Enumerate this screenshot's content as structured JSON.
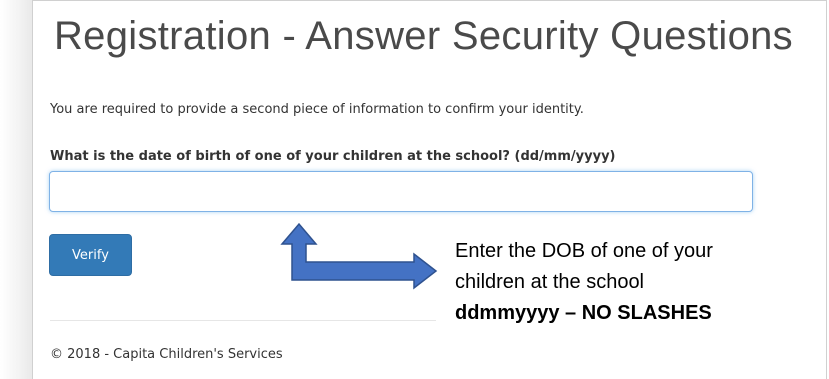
{
  "page": {
    "title": "Registration - Answer Security Questions",
    "intro": "You are required to provide a second piece of information to confirm your identity."
  },
  "form": {
    "question_label": "What is the date of birth of one of your children at the school? (dd/mm/yyyy)",
    "dob_value": "",
    "dob_placeholder": "",
    "verify_label": "Verify"
  },
  "footer": {
    "copyright": "© 2018 - Capita Children's Services"
  },
  "annotation": {
    "line1": "Enter the DOB of one of your",
    "line2": "children at the school",
    "line3": "ddmmyyyy – NO SLASHES",
    "arrow_icon": "bent-double-arrow-icon"
  },
  "colors": {
    "button_bg": "#337ab7",
    "input_focus_border": "#7fb2e6",
    "arrow_fill": "#4472c4",
    "arrow_stroke": "#2f528f"
  }
}
